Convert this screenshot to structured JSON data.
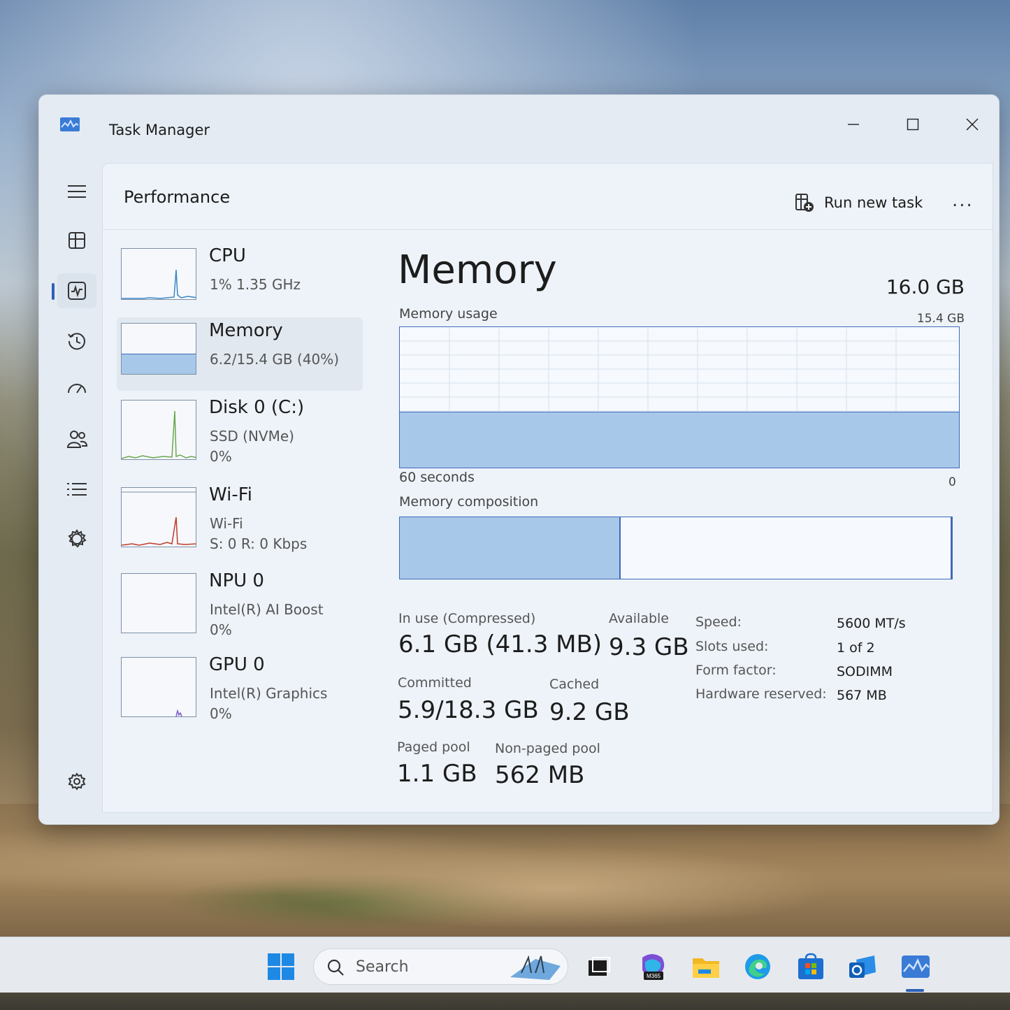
{
  "window": {
    "title": "Task Manager"
  },
  "header": {
    "page_title": "Performance",
    "run_new_task": "Run new task",
    "more": "..."
  },
  "nav": [
    {
      "name": "hamburger-menu-icon"
    },
    {
      "name": "processes-icon"
    },
    {
      "name": "performance-icon",
      "active": true
    },
    {
      "name": "app-history-icon"
    },
    {
      "name": "startup-apps-icon"
    },
    {
      "name": "users-icon"
    },
    {
      "name": "details-icon"
    },
    {
      "name": "services-icon"
    },
    {
      "name": "settings-icon"
    }
  ],
  "resources": [
    {
      "name": "CPU",
      "line1": "1%  1.35 GHz",
      "line2": "",
      "color": "#3a86c8"
    },
    {
      "name": "Memory",
      "line1": "6.2/15.4 GB (40%)",
      "line2": "",
      "color": "#3e6bb8",
      "selected": true
    },
    {
      "name": "Disk 0 (C:)",
      "line1": "SSD (NVMe)",
      "line2": "0%",
      "color": "#6aa84f"
    },
    {
      "name": "Wi-Fi",
      "line1": "Wi-Fi",
      "line2": "S: 0  R: 0 Kbps",
      "color": "#c0392b"
    },
    {
      "name": "NPU 0",
      "line1": "Intel(R) AI Boost",
      "line2": "0%",
      "color": "#3a86c8"
    },
    {
      "name": "GPU 0",
      "line1": "Intel(R) Graphics",
      "line2": "0%",
      "color": "#7a5ec8"
    }
  ],
  "memory": {
    "title": "Memory",
    "total": "16.0 GB",
    "usage_label": "Memory usage",
    "usage_max": "15.4 GB",
    "time_span": "60 seconds",
    "zero": "0",
    "usage_fraction": 0.4,
    "composition_label": "Memory composition",
    "in_use_fraction": 0.4,
    "stats": {
      "in_use_label": "In use (Compressed)",
      "in_use_value": "6.1 GB (41.3 MB)",
      "available_label": "Available",
      "available_value": "9.3 GB",
      "committed_label": "Committed",
      "committed_value": "5.9/18.3 GB",
      "cached_label": "Cached",
      "cached_value": "9.2 GB",
      "paged_label": "Paged pool",
      "paged_value": "1.1 GB",
      "nonpaged_label": "Non-paged pool",
      "nonpaged_value": "562 MB"
    },
    "specs": {
      "speed_label": "Speed:",
      "speed_value": "5600 MT/s",
      "slots_label": "Slots used:",
      "slots_value": "1 of 2",
      "form_label": "Form factor:",
      "form_value": "SODIMM",
      "hw_label": "Hardware reserved:",
      "hw_value": "567 MB"
    }
  },
  "taskbar": {
    "search_placeholder": "Search",
    "m365_badge": "M365"
  },
  "colors": {
    "accent": "#2b62b8",
    "memory_fill": "#a8c8ea",
    "memory_line": "#3e6bb8"
  }
}
